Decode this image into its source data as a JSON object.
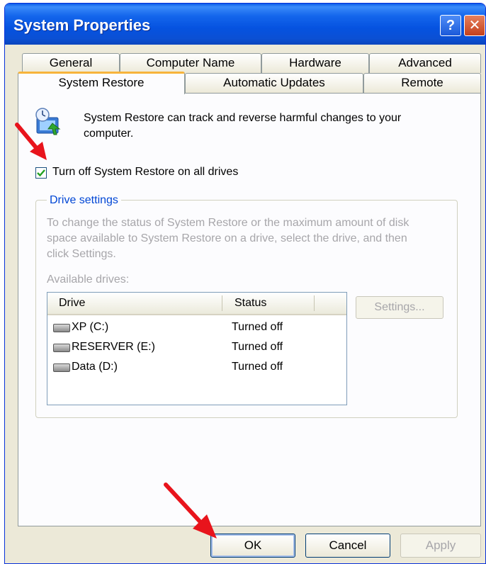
{
  "window": {
    "title": "System Properties",
    "help_glyph": "?",
    "close_glyph": "✕"
  },
  "tabs_row1": [
    "General",
    "Computer Name",
    "Hardware",
    "Advanced"
  ],
  "tabs_row2": [
    "System Restore",
    "Automatic Updates",
    "Remote"
  ],
  "active_tab": "System Restore",
  "restore": {
    "intro_line1": "System Restore can track and reverse harmful changes to your",
    "intro_line2": "computer.",
    "checkbox_label": "Turn off System Restore on all drives",
    "checkbox_checked": true
  },
  "drive_settings": {
    "group_title": "Drive settings",
    "desc_line1": "To change the status of System Restore or the maximum amount of disk",
    "desc_line2": "space available to System Restore on a drive, select the drive, and then",
    "desc_line3": "click Settings.",
    "available_label": "Available drives:",
    "columns": [
      "Drive",
      "Status"
    ],
    "drives": [
      {
        "name": "XP (C:)",
        "status": "Turned off"
      },
      {
        "name": "RESERVER (E:)",
        "status": "Turned off"
      },
      {
        "name": "Data (D:)",
        "status": "Turned off"
      }
    ],
    "settings_button": "Settings..."
  },
  "buttons": {
    "ok": "OK",
    "cancel": "Cancel",
    "apply": "Apply"
  },
  "colors": {
    "title_blue": "#0a5ce8",
    "annotation_arrow": "#e8141c",
    "group_title": "#0046d5",
    "disabled_text": "#a7a6aa"
  }
}
